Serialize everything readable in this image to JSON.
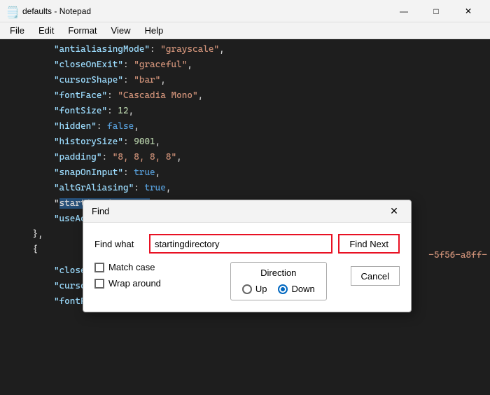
{
  "titleBar": {
    "icon": "📄",
    "title": "defaults - Notepad",
    "minBtn": "—",
    "maxBtn": "□",
    "closeBtn": "✕"
  },
  "menuBar": {
    "items": [
      "File",
      "Edit",
      "Format",
      "View",
      "Help"
    ]
  },
  "codeLines": [
    "        \"antialiasingMode\": \"grayscale\",",
    "        \"closeOnExit\": \"graceful\",",
    "        \"cursorShape\": \"bar\",",
    "        \"fontFace\": \"Cascadia Mono\",",
    "        \"fontSize\": 12,",
    "        \"hidden\": false,",
    "        \"historySize\": 9001,",
    "        \"padding\": \"8, 8, 8, 8\",",
    "        \"snapOnInput\": true,",
    "        \"altGrAliasing\": true,",
    "        \"startingDirectory\": \"%USERPROFILE%\",",
    "        \"useAcryllic\": false"
  ],
  "closingLines": [
    "    },",
    "    {"
  ],
  "bottomLines": [
    "        \"closeOnExit\": \"graceful\",",
    "        \"cursorShape\": \"bar\",",
    "        \"fontFace\": \"Cascadia Mono\""
  ],
  "dialog": {
    "title": "Find",
    "closeBtn": "✕",
    "findWhatLabel": "Find what",
    "findWhatValue": "startingdirectory",
    "findWhatPlaceholder": "",
    "findNextLabel": "Find Next",
    "cancelLabel": "Cancel",
    "directionLabel": "Direction",
    "upLabel": "Up",
    "downLabel": "Down",
    "matchCaseLabel": "Match case",
    "wrapAroundLabel": "Wrap around",
    "downChecked": true,
    "upChecked": false,
    "matchCaseChecked": false,
    "wrapAroundChecked": false
  },
  "cutoffText": "-5f56-a8ff-"
}
